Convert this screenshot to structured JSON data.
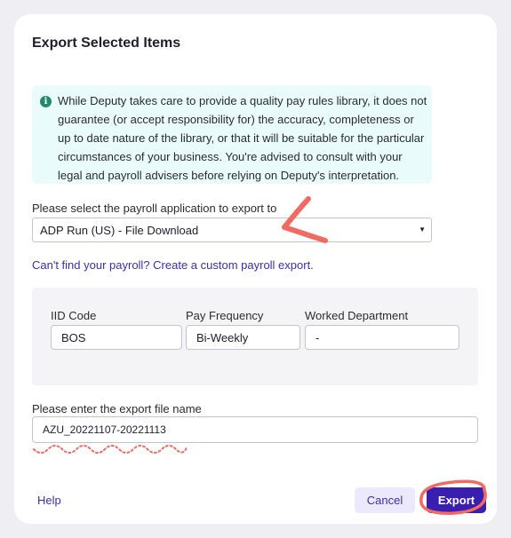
{
  "dialog": {
    "title": "Export Selected Items",
    "notice": "While Deputy takes care to provide a quality pay rules library, it does not guarantee (or accept responsibility for) the accuracy, completeness or up to date nature of the library, or that it will be suitable for the particular circumstances of your business. You're advised to consult with your legal and payroll advisers before relying on Deputy's interpretation.",
    "notice_icon": "info-icon"
  },
  "payroll": {
    "label": "Please select the payroll application to export to",
    "selected": "ADP Run (US) - File Download",
    "custom_link": "Can't find your payroll? Create a custom payroll export."
  },
  "fields": [
    {
      "label": "IID Code",
      "value": "BOS"
    },
    {
      "label": "Pay Frequency",
      "value": "Bi-Weekly"
    },
    {
      "label": "Worked Department",
      "value": "-"
    }
  ],
  "filename": {
    "label": "Please enter the export file name",
    "value": "AZU_20221107-20221113"
  },
  "footer": {
    "help": "Help",
    "cancel": "Cancel",
    "export": "Export"
  },
  "colors": {
    "accent": "#3a1eb0",
    "link": "#3a2fb0",
    "annotation": "#f26b63",
    "notice_bg": "#e9fbfa"
  }
}
